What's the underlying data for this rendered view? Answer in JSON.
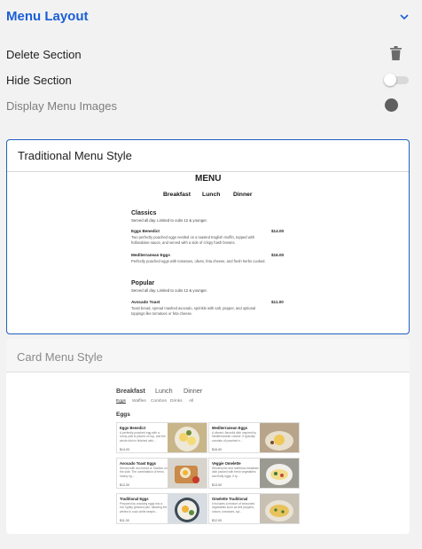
{
  "panel": {
    "title": "Menu Layout"
  },
  "settings": {
    "delete_label": "Delete Section",
    "hide_label": "Hide Section",
    "display_images_label": "Display Menu Images"
  },
  "traditional": {
    "label": "Traditional Menu Style",
    "menu_title": "MENU",
    "tabs": [
      "Breakfast",
      "Lunch",
      "Dinner"
    ],
    "sections": [
      {
        "heading": "Classics",
        "subtitle": "Served all day. Limited to cubs 12 & younger.",
        "items": [
          {
            "name": "Eggs Benedict",
            "price": "$14.00",
            "desc": "Two perfectly poached eggs nestled on a toasted English muffin, topped with hollandaise sauce, and served with a side of crispy hash browns."
          },
          {
            "name": "Mediterranean Eggs",
            "price": "$16.00",
            "desc": "Perfectly poached eggs with tomatoes, olives, feta cheese, and fresh herbs cooked."
          }
        ]
      },
      {
        "heading": "Popular",
        "subtitle": "Served all day. Limited to cubs 12 & younger.",
        "items": [
          {
            "name": "Avocado Toast",
            "price": "$11.00",
            "desc": "Toast bread, spread mashed avocado, sprinkle with salt, pepper, and optional toppings like tomatoes or feta cheese."
          }
        ]
      }
    ]
  },
  "card_style": {
    "label": "Card Menu Style",
    "tabs": [
      "Breakfast",
      "Lunch",
      "Dinner"
    ],
    "subtabs": [
      "Eggs",
      "Waffles",
      "Combos",
      "Drinks",
      "All"
    ],
    "heading": "Eggs",
    "cards": [
      {
        "name": "Eggs Benedict",
        "desc": "A perfectly poached egg with a runny yolk is placed on top, and the whole dish is finished with...",
        "price": "$14.00"
      },
      {
        "name": "Mediterranean Eggs",
        "desc": "A vibrant, flavorful dish inspired by Mediterranean cuisine. It typically consists of poached e...",
        "price": "$16.00"
      },
      {
        "name": "Avocado Toast Eggs",
        "desc": "Served with avo bread or Scallion on the side. The combination of fresh, hearty eg...",
        "price": "$12.00"
      },
      {
        "name": "Veggie Omelette",
        "desc": "Wholesome and nutritious breakfast dish packed with fresh vegetables and fluffy eggs. It ty...",
        "price": "$13.00"
      },
      {
        "name": "Traditional Eggs",
        "desc": "Prepared by cracking eggs into a hot, lightly greased pan, allowing the whites to cook while keepin...",
        "price": "$11.00"
      },
      {
        "name": "Omelette Traditional",
        "desc": "It includes a mixture of seasoned vegetables such as bell peppers, onions, tomatoes, spi...",
        "price": "$12.00"
      }
    ]
  },
  "colors": {
    "accent": "#1a5fd6",
    "selected_border": "#1f5fbf",
    "toggle_disabled": "#5f5f5f"
  },
  "icons": {
    "collapse": "chevron-down-icon",
    "delete": "trash-icon"
  }
}
